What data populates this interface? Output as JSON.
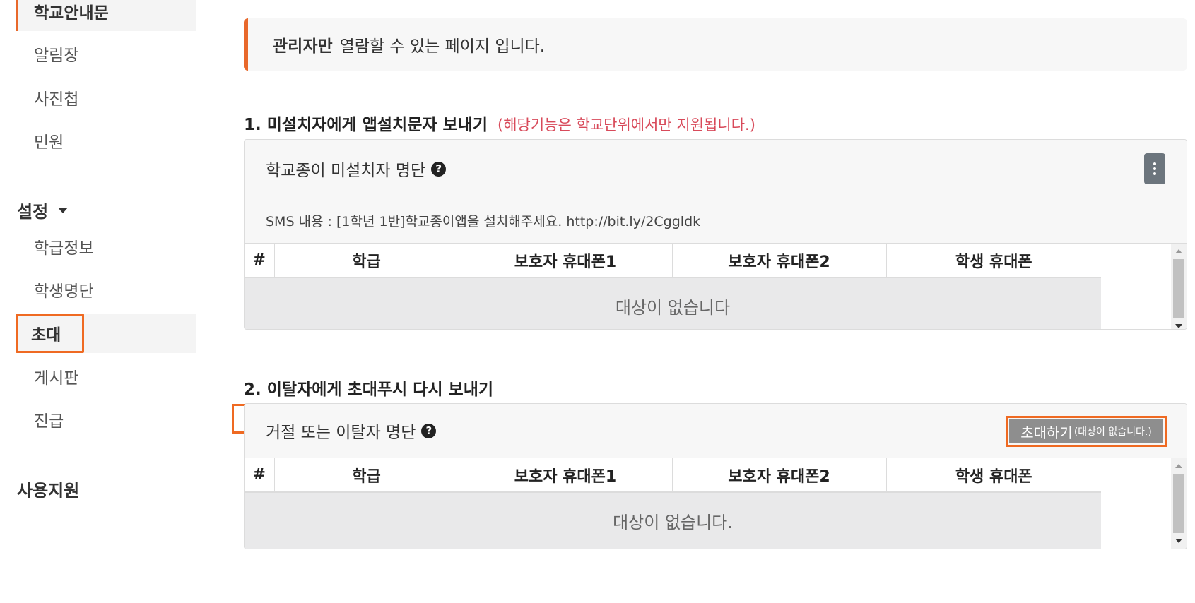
{
  "sidebar": {
    "school_notice": "학교안내문",
    "notices": "알림장",
    "photo_album": "사진첩",
    "complaint": "민원",
    "settings_section": "설정",
    "class_info": "학급정보",
    "student_list": "학생명단",
    "invite": "초대",
    "board": "게시판",
    "urgent": "진급",
    "support_section": "사용지원"
  },
  "notice": {
    "bold": "관리자만",
    "text": "열람할 수 있는 페이지 입니다."
  },
  "section1": {
    "title": "1. 미설치자에게 앱설치문자 보내기",
    "note": "(해당기능은 학교단위에서만 지원됩니다.)",
    "panel_title": "학교종이 미설치자 명단",
    "sms_text": "SMS 내용 : [1학년 1반]학교종이앱을 설치해주세요. http://bit.ly/2Cggldk",
    "columns": [
      "#",
      "학급",
      "보호자 휴대폰1",
      "보호자 휴대폰2",
      "학생 휴대폰"
    ],
    "empty_text": "대상이 없습니다"
  },
  "section2": {
    "title": "2. 이탈자에게 초대푸시 다시 보내기",
    "panel_title": "거절 또는 이탈자 명단",
    "invite_button": "초대하기",
    "invite_button_note": "(대상이 없습니다.)",
    "columns": [
      "#",
      "학급",
      "보호자 휴대폰1",
      "보호자 휴대폰2",
      "학생 휴대폰"
    ],
    "empty_text": "대상이 없습니다."
  },
  "colors": {
    "accent": "#e8682b",
    "highlight_box": "#ef6a22",
    "note_red": "#d84a5a"
  }
}
